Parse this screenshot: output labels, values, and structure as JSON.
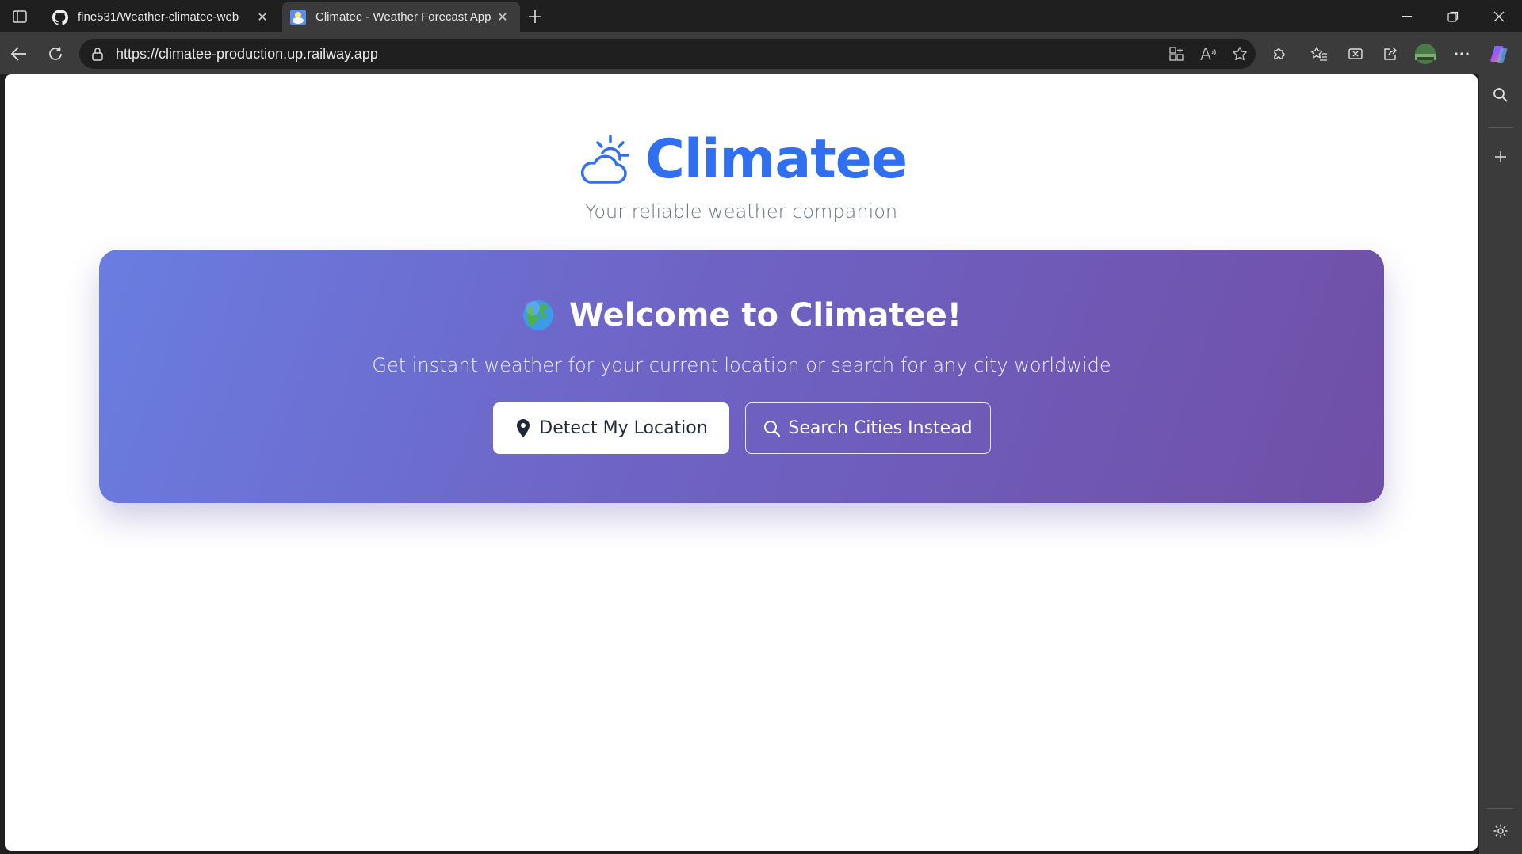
{
  "browser": {
    "tabs": [
      {
        "title": "fine531/Weather-climatee-web",
        "favicon": "github-icon",
        "active": false
      },
      {
        "title": "Climatee - Weather Forecast App",
        "favicon": "climatee-favicon",
        "active": true
      }
    ],
    "address_bar": {
      "url": "https://climatee-production.up.railway.app"
    },
    "colors": {
      "chrome_dark": "#1f1f1f",
      "chrome_toolbar": "#3b3b3b"
    }
  },
  "page": {
    "brand": {
      "name": "Climatee",
      "icon": "cloud-sun-icon",
      "tagline": "Your reliable weather companion"
    },
    "welcome": {
      "emoji_icon": "globe-icon",
      "title": "Welcome to Climatee!",
      "subtitle": "Get instant weather for your current location or search for any city worldwide",
      "detect_button": {
        "label": "Detect My Location",
        "icon": "map-pin-icon"
      },
      "search_button": {
        "label": "Search Cities Instead",
        "icon": "search-icon"
      }
    },
    "colors": {
      "brand_blue": "#2f6ff0",
      "gradient_start": "#6a7de0",
      "gradient_end": "#704fa6"
    }
  }
}
